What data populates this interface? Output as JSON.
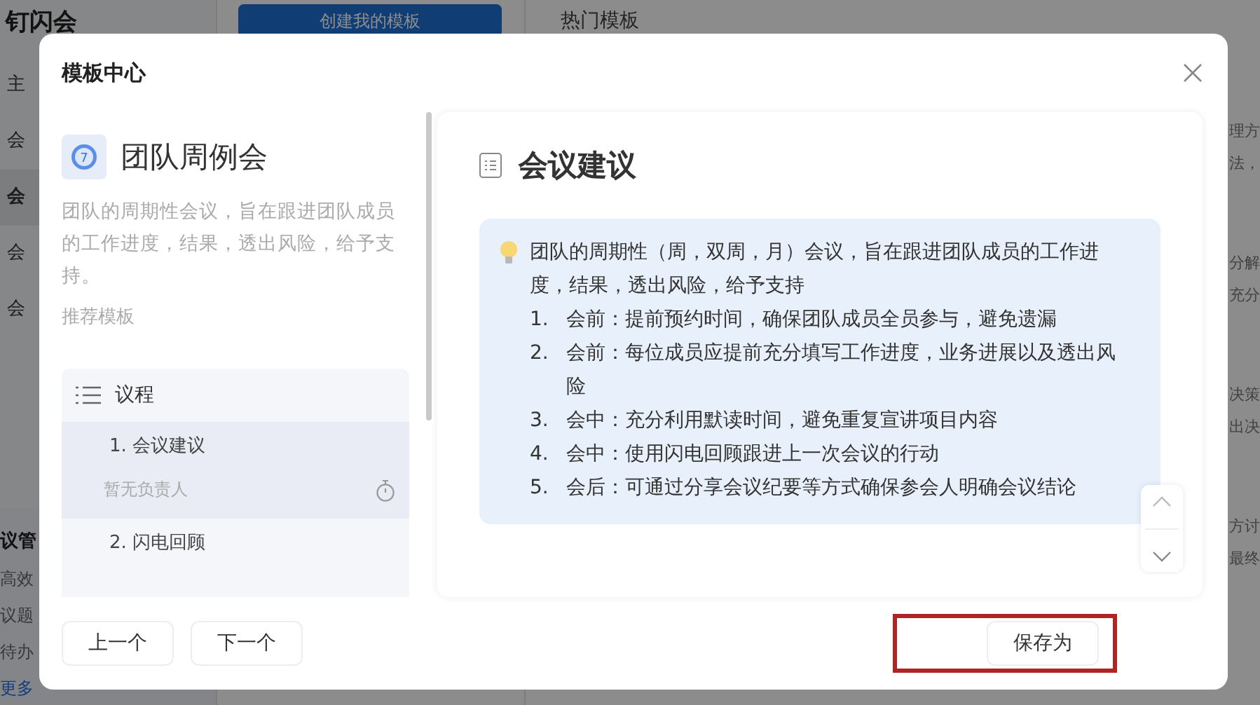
{
  "background_app": {
    "app_title": "钉闪会",
    "sidebar_items": [
      {
        "label": "主",
        "selected": false
      },
      {
        "label": "会",
        "selected": false
      },
      {
        "label": "会",
        "selected": true
      },
      {
        "label": "会",
        "selected": false
      },
      {
        "label": "会",
        "selected": false
      }
    ],
    "create_button": "创建我的模板",
    "section_title": "热门模板",
    "side_panel": {
      "title": "议管",
      "lines": [
        "高效",
        "议题",
        "待办"
      ],
      "link": "更多"
    },
    "right_snippets": [
      [
        "理方",
        "法，"
      ],
      [
        "分解",
        "充分"
      ],
      [
        "决策",
        "出决"
      ],
      [
        "方讨",
        "最终"
      ]
    ]
  },
  "modal": {
    "title": "模板中心",
    "template": {
      "icon_text": "7",
      "name": "团队周例会",
      "description": "团队的周期性会议，旨在跟进团队成员的工作进度，结果，透出风险，给予支持。",
      "recommend_label": "推荐模板"
    },
    "agenda": {
      "title": "议程",
      "items": [
        {
          "label": "1. 会议建议",
          "owner": "暂无负责人",
          "selected": true
        },
        {
          "label": "2. 闪电回顾",
          "selected": false
        }
      ]
    },
    "content": {
      "heading": "会议建议",
      "tip": {
        "intro": "团队的周期性（周，双周，月）会议，旨在跟进团队成员的工作进度，结果，透出风险，给予支持",
        "steps": [
          {
            "number": "1.",
            "text": "会前：提前预约时间，确保团队成员全员参与，避免遗漏"
          },
          {
            "number": "2.",
            "text": "会前：每位成员应提前充分填写工作进度，业务进展以及透出风险"
          },
          {
            "number": "3.",
            "text": "会中：充分利用默读时间，避免重复宣讲项目内容"
          },
          {
            "number": "4.",
            "text": "会中：使用闪电回顾跟进上一次会议的行动"
          },
          {
            "number": "5.",
            "text": "会后：可通过分享会议纪要等方式确保参会人明确会议结论"
          }
        ]
      }
    },
    "prev_button": "上一个",
    "next_button": "下一个",
    "save_button": "保存为"
  }
}
